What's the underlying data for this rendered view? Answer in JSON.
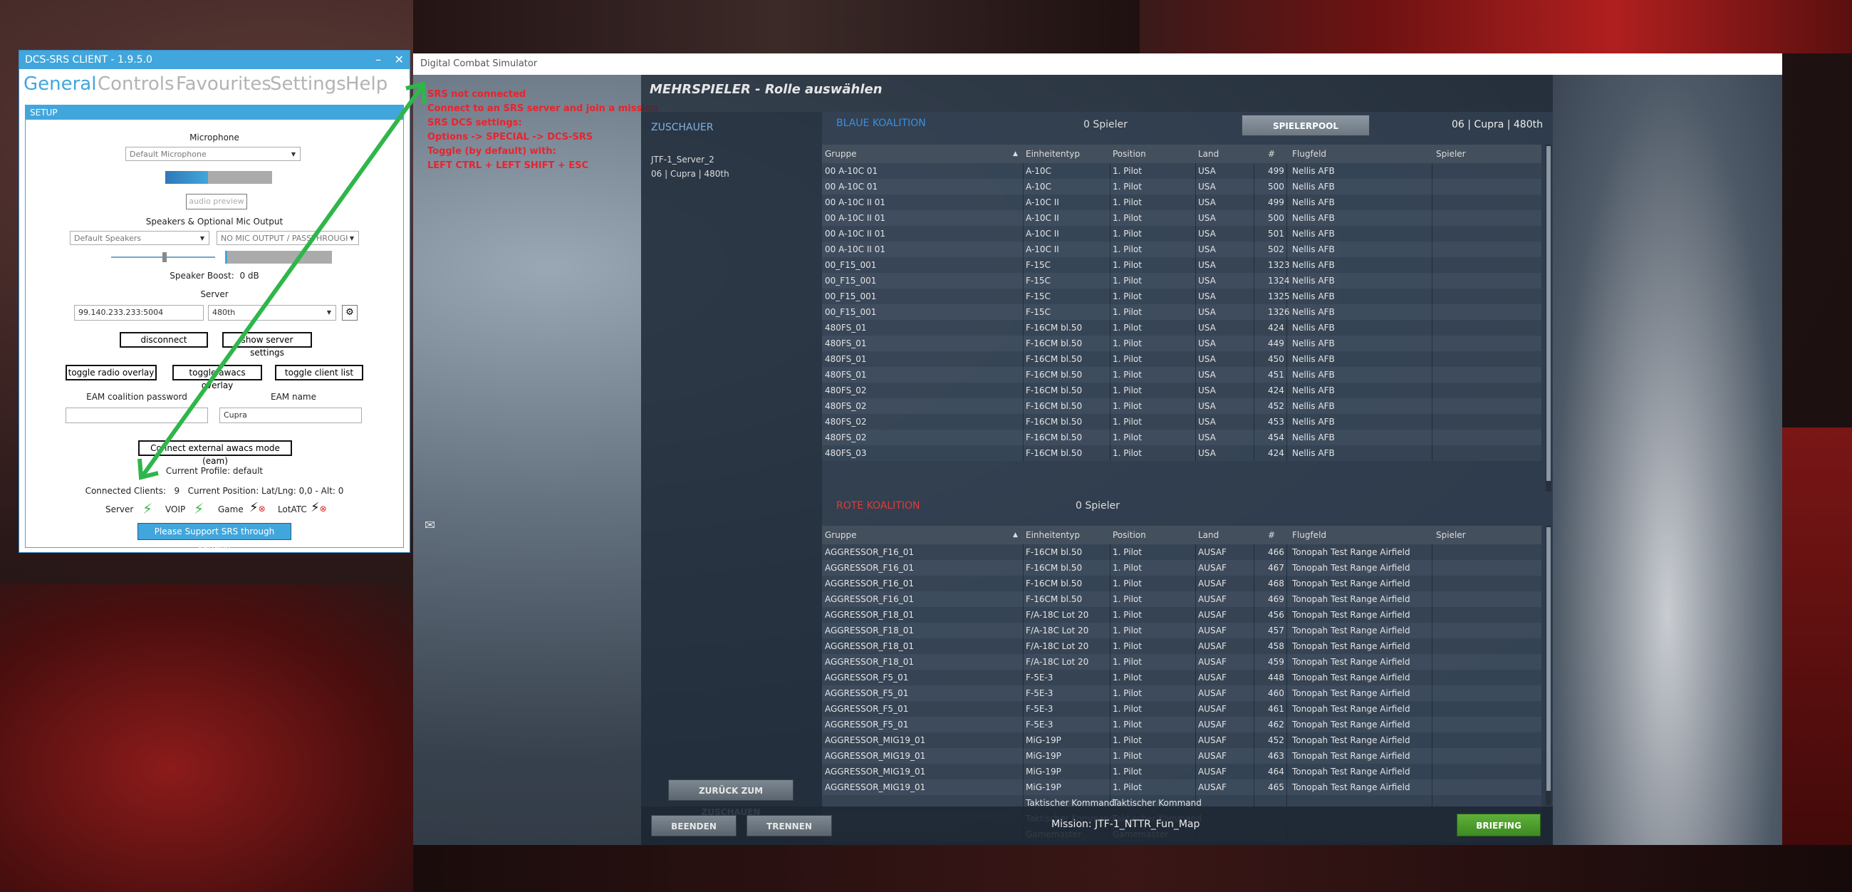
{
  "srs": {
    "title": "DCS-SRS CLIENT - 1.9.5.0",
    "minimize": "–",
    "close": "✕",
    "tabs": [
      "General",
      "Controls",
      "Favourites",
      "Settings",
      "Help"
    ],
    "setup_label": "SETUP",
    "microphone_label": "Microphone",
    "microphone_value": "Default Microphone",
    "audio_preview": "audio preview",
    "speakers_label": "Speakers & Optional Mic Output",
    "speakers_value": "Default Speakers",
    "mic_output_value": "NO MIC OUTPUT / PASSTHROUGH",
    "speaker_boost_label": "Speaker Boost:",
    "speaker_boost_value": "0 dB",
    "server_label": "Server",
    "server_address": "99.140.233.233:5004",
    "server_profile": "480th",
    "disconnect": "disconnect",
    "show_server_settings": "show server settings",
    "toggle_radio_overlay": "toggle radio overlay",
    "toggle_awacs_overlay": "toggle awacs overlay",
    "toggle_client_list": "toggle client list",
    "eam_password_label": "EAM coalition password",
    "eam_name_label": "EAM name",
    "eam_name_value": "Cupra",
    "eam_button": "Connect external awacs mode (eam)",
    "current_profile": "Current Profile: default",
    "connected_clients_label": "Connected Clients:",
    "connected_clients_value": "9",
    "current_position": "Current Position: Lat/Lng: 0,0 - Alt: 0",
    "status_server": "Server",
    "status_voip": "VOIP",
    "status_game": "Game",
    "status_lotatc": "LotATC",
    "patreon": "Please Support SRS through Patreon",
    "colors": {
      "accent": "#41a6dc",
      "ok": "#3cb44a",
      "err": "#e0232a"
    }
  },
  "dcs": {
    "window_title": "Digital Combat Simulator",
    "srs_messages": [
      "SRS not connected",
      "Connect to an SRS server and join a mission",
      "SRS DCS settings:",
      "Options -> SPECIAL -> DCS-SRS",
      "Toggle (by default) with:",
      "LEFT CTRL + LEFT SHIFT + ESC"
    ],
    "panel_title": "MEHRSPIELER - Rolle auswählen",
    "spectators": "ZUSCHAUER",
    "server_name": "JTF-1_Server_2",
    "server_info": "06 | Cupra | 480th",
    "blue_coalition": "BLAUE KOALITION",
    "blue_players": "0 Spieler",
    "pool_button": "SPIELERPOOL",
    "top_right_info": "06 | Cupra | 480th",
    "red_coalition": "ROTE KOALITION",
    "red_players": "0 Spieler",
    "columns": [
      "Gruppe",
      "Einheitentyp",
      "Position",
      "Land",
      "#",
      "Flugfeld",
      "Spieler"
    ],
    "blue_rows": [
      [
        "00 A-10C 01",
        "A-10C",
        "1. Pilot",
        "USA",
        "499",
        "Nellis AFB",
        ""
      ],
      [
        "00 A-10C 01",
        "A-10C",
        "1. Pilot",
        "USA",
        "500",
        "Nellis AFB",
        ""
      ],
      [
        "00 A-10C II 01",
        "A-10C II",
        "1. Pilot",
        "USA",
        "499",
        "Nellis AFB",
        ""
      ],
      [
        "00 A-10C II 01",
        "A-10C II",
        "1. Pilot",
        "USA",
        "500",
        "Nellis AFB",
        ""
      ],
      [
        "00 A-10C II 01",
        "A-10C II",
        "1. Pilot",
        "USA",
        "501",
        "Nellis AFB",
        ""
      ],
      [
        "00 A-10C II 01",
        "A-10C II",
        "1. Pilot",
        "USA",
        "502",
        "Nellis AFB",
        ""
      ],
      [
        "00_F15_001",
        "F-15C",
        "1. Pilot",
        "USA",
        "1323",
        "Nellis AFB",
        ""
      ],
      [
        "00_F15_001",
        "F-15C",
        "1. Pilot",
        "USA",
        "1324",
        "Nellis AFB",
        ""
      ],
      [
        "00_F15_001",
        "F-15C",
        "1. Pilot",
        "USA",
        "1325",
        "Nellis AFB",
        ""
      ],
      [
        "00_F15_001",
        "F-15C",
        "1. Pilot",
        "USA",
        "1326",
        "Nellis AFB",
        ""
      ],
      [
        "480FS_01",
        "F-16CM bl.50",
        "1. Pilot",
        "USA",
        "424",
        "Nellis AFB",
        ""
      ],
      [
        "480FS_01",
        "F-16CM bl.50",
        "1. Pilot",
        "USA",
        "449",
        "Nellis AFB",
        ""
      ],
      [
        "480FS_01",
        "F-16CM bl.50",
        "1. Pilot",
        "USA",
        "450",
        "Nellis AFB",
        ""
      ],
      [
        "480FS_01",
        "F-16CM bl.50",
        "1. Pilot",
        "USA",
        "451",
        "Nellis AFB",
        ""
      ],
      [
        "480FS_02",
        "F-16CM bl.50",
        "1. Pilot",
        "USA",
        "424",
        "Nellis AFB",
        ""
      ],
      [
        "480FS_02",
        "F-16CM bl.50",
        "1. Pilot",
        "USA",
        "452",
        "Nellis AFB",
        ""
      ],
      [
        "480FS_02",
        "F-16CM bl.50",
        "1. Pilot",
        "USA",
        "453",
        "Nellis AFB",
        ""
      ],
      [
        "480FS_02",
        "F-16CM bl.50",
        "1. Pilot",
        "USA",
        "454",
        "Nellis AFB",
        ""
      ],
      [
        "480FS_03",
        "F-16CM bl.50",
        "1. Pilot",
        "USA",
        "424",
        "Nellis AFB",
        ""
      ]
    ],
    "red_rows": [
      [
        "AGGRESSOR_F16_01",
        "F-16CM bl.50",
        "1. Pilot",
        "AUSAF",
        "466",
        "Tonopah Test Range Airfield",
        ""
      ],
      [
        "AGGRESSOR_F16_01",
        "F-16CM bl.50",
        "1. Pilot",
        "AUSAF",
        "467",
        "Tonopah Test Range Airfield",
        ""
      ],
      [
        "AGGRESSOR_F16_01",
        "F-16CM bl.50",
        "1. Pilot",
        "AUSAF",
        "468",
        "Tonopah Test Range Airfield",
        ""
      ],
      [
        "AGGRESSOR_F16_01",
        "F-16CM bl.50",
        "1. Pilot",
        "AUSAF",
        "469",
        "Tonopah Test Range Airfield",
        ""
      ],
      [
        "AGGRESSOR_F18_01",
        "F/A-18C Lot 20",
        "1. Pilot",
        "AUSAF",
        "456",
        "Tonopah Test Range Airfield",
        ""
      ],
      [
        "AGGRESSOR_F18_01",
        "F/A-18C Lot 20",
        "1. Pilot",
        "AUSAF",
        "457",
        "Tonopah Test Range Airfield",
        ""
      ],
      [
        "AGGRESSOR_F18_01",
        "F/A-18C Lot 20",
        "1. Pilot",
        "AUSAF",
        "458",
        "Tonopah Test Range Airfield",
        ""
      ],
      [
        "AGGRESSOR_F18_01",
        "F/A-18C Lot 20",
        "1. Pilot",
        "AUSAF",
        "459",
        "Tonopah Test Range Airfield",
        ""
      ],
      [
        "AGGRESSOR_F5_01",
        "F-5E-3",
        "1. Pilot",
        "AUSAF",
        "448",
        "Tonopah Test Range Airfield",
        ""
      ],
      [
        "AGGRESSOR_F5_01",
        "F-5E-3",
        "1. Pilot",
        "AUSAF",
        "460",
        "Tonopah Test Range Airfield",
        ""
      ],
      [
        "AGGRESSOR_F5_01",
        "F-5E-3",
        "1. Pilot",
        "AUSAF",
        "461",
        "Tonopah Test Range Airfield",
        ""
      ],
      [
        "AGGRESSOR_F5_01",
        "F-5E-3",
        "1. Pilot",
        "AUSAF",
        "462",
        "Tonopah Test Range Airfield",
        ""
      ],
      [
        "AGGRESSOR_MIG19_01",
        "MiG-19P",
        "1. Pilot",
        "AUSAF",
        "452",
        "Tonopah Test Range Airfield",
        ""
      ],
      [
        "AGGRESSOR_MIG19_01",
        "MiG-19P",
        "1. Pilot",
        "AUSAF",
        "463",
        "Tonopah Test Range Airfield",
        ""
      ],
      [
        "AGGRESSOR_MIG19_01",
        "MiG-19P",
        "1. Pilot",
        "AUSAF",
        "464",
        "Tonopah Test Range Airfield",
        ""
      ],
      [
        "AGGRESSOR_MIG19_01",
        "MiG-19P",
        "1. Pilot",
        "AUSAF",
        "465",
        "Tonopah Test Range Airfield",
        ""
      ],
      [
        "",
        "Taktischer Kommand",
        "Taktischer Kommand",
        "",
        "",
        "",
        ""
      ],
      [
        "",
        "Taktischer Kommand",
        "Taktischer Kommand",
        "",
        "",
        "",
        ""
      ],
      [
        "",
        "Gamemaster",
        "Gamemaster",
        "",
        "",
        "",
        ""
      ]
    ],
    "back_to_spectators": "ZURÜCK ZUM ZUSCHAUEN",
    "quit": "BEENDEN",
    "disconnect": "TRENNEN",
    "mission": "Mission: JTF-1_NTTR_Fun_Map",
    "briefing": "BRIEFING",
    "colors": {
      "blue": "#3b8fe0",
      "red": "#e23b3b",
      "briefing": "#4a9a2c"
    }
  }
}
